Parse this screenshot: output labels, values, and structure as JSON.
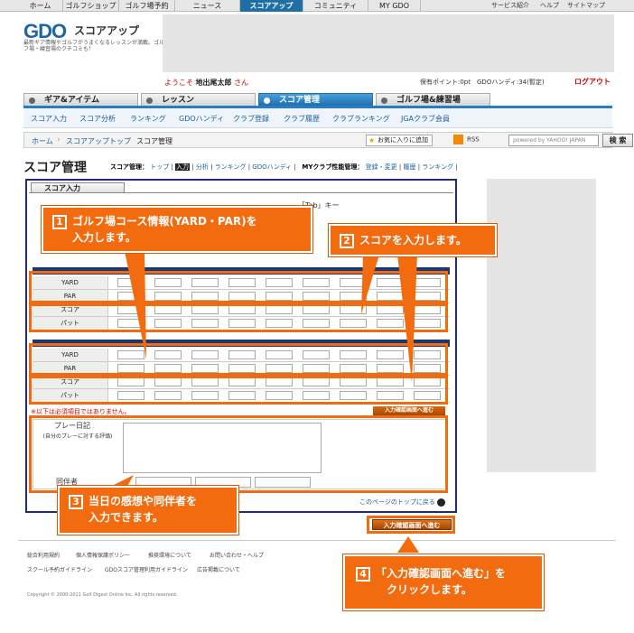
{
  "topnav": {
    "items": [
      "ホーム",
      "ゴルフショップ",
      "ゴルフ場予約",
      "ニュース",
      "スコアアップ",
      "コミュニティ",
      "MY GDO"
    ],
    "utility": [
      "サービス紹介",
      "ヘルプ",
      "サイトマップ"
    ]
  },
  "header": {
    "logo": "GDO",
    "section": "スコアアップ",
    "tagline": "最新ギア情報やゴルフがうまくなるレッスンが満載。ゴルフ場・練習場のクチコミも！",
    "welcome_prefix": "ようこそ",
    "user_name": "地出尾太郎",
    "welcome_suffix": "さん",
    "points": "保有ポイント:0pt　GDOハンディ:34(暫定)",
    "logout": "ログアウト"
  },
  "category_tabs": [
    "ギア&アイテム",
    "レッスン",
    "スコア管理",
    "ゴルフ場&練習場"
  ],
  "subnav": [
    "スコア入力",
    "スコア分析",
    "ランキング",
    "GDOハンディ",
    "クラブ登録",
    "クラブ履歴",
    "クラブランキング",
    "JGAクラブ会員"
  ],
  "breadcrumb": {
    "items": [
      "ホーム",
      "スコアアップトップ",
      "スコア管理"
    ],
    "favorite": "お気に入りに追加",
    "rss": "RSS",
    "search_placeholder": "powered by YAHOO! JAPAN",
    "search_button": "検 索"
  },
  "page": {
    "title": "スコア管理",
    "nav_label": "スコア管理：",
    "nav_items": [
      "トップ",
      "入力",
      "分析",
      "ランキング",
      "GDOハンディ"
    ],
    "club_label": "MYクラブ性能管理：",
    "club_items": [
      "登録・変更",
      "履歴",
      "ランキング"
    ]
  },
  "panel": {
    "tab_title": "スコア入力",
    "hint": "「Tab」キー",
    "row_labels": [
      "YARD",
      "PAR",
      "スコア",
      "パット"
    ],
    "required_note": "※以下は必須項目ではありません。",
    "mini_button": "入力確認画面へ進む",
    "diary_label": "プレー日記",
    "diary_sub": "(自分のプレーに対する評価)",
    "companion_label": "同伴者",
    "page_top": "このページのトップに戻る",
    "confirm_button": "入力確認画面へ進む"
  },
  "footer": {
    "row1": [
      "総合利用規約",
      "個人情報保護ポリシー",
      "推奨環境について",
      "お問い合わせ・ヘルプ"
    ],
    "row2": [
      "スクール予約ガイドライン",
      "GDOスコア管理利用ガイドライン",
      "広告掲載について"
    ],
    "copyright": "Copyright © 2000-2011 Golf Digest Online Inc. All rights reserved."
  },
  "callouts": [
    {
      "num": "1",
      "text1": "ゴルフ場コース情報(YARD・PAR)を",
      "text2": "入力します。"
    },
    {
      "num": "2",
      "text1": "スコアを入力します。",
      "text2": ""
    },
    {
      "num": "3",
      "text1": "当日の感想や同伴者を",
      "text2": "入力できます。"
    },
    {
      "num": "4",
      "text1": "「入力確認画面へ進む」を",
      "text2": "クリックします。"
    }
  ],
  "colors": {
    "accent": "#f26b0f",
    "navy": "#1d3771",
    "link": "#1b5fa0",
    "active_tab": "#1e6fae"
  }
}
